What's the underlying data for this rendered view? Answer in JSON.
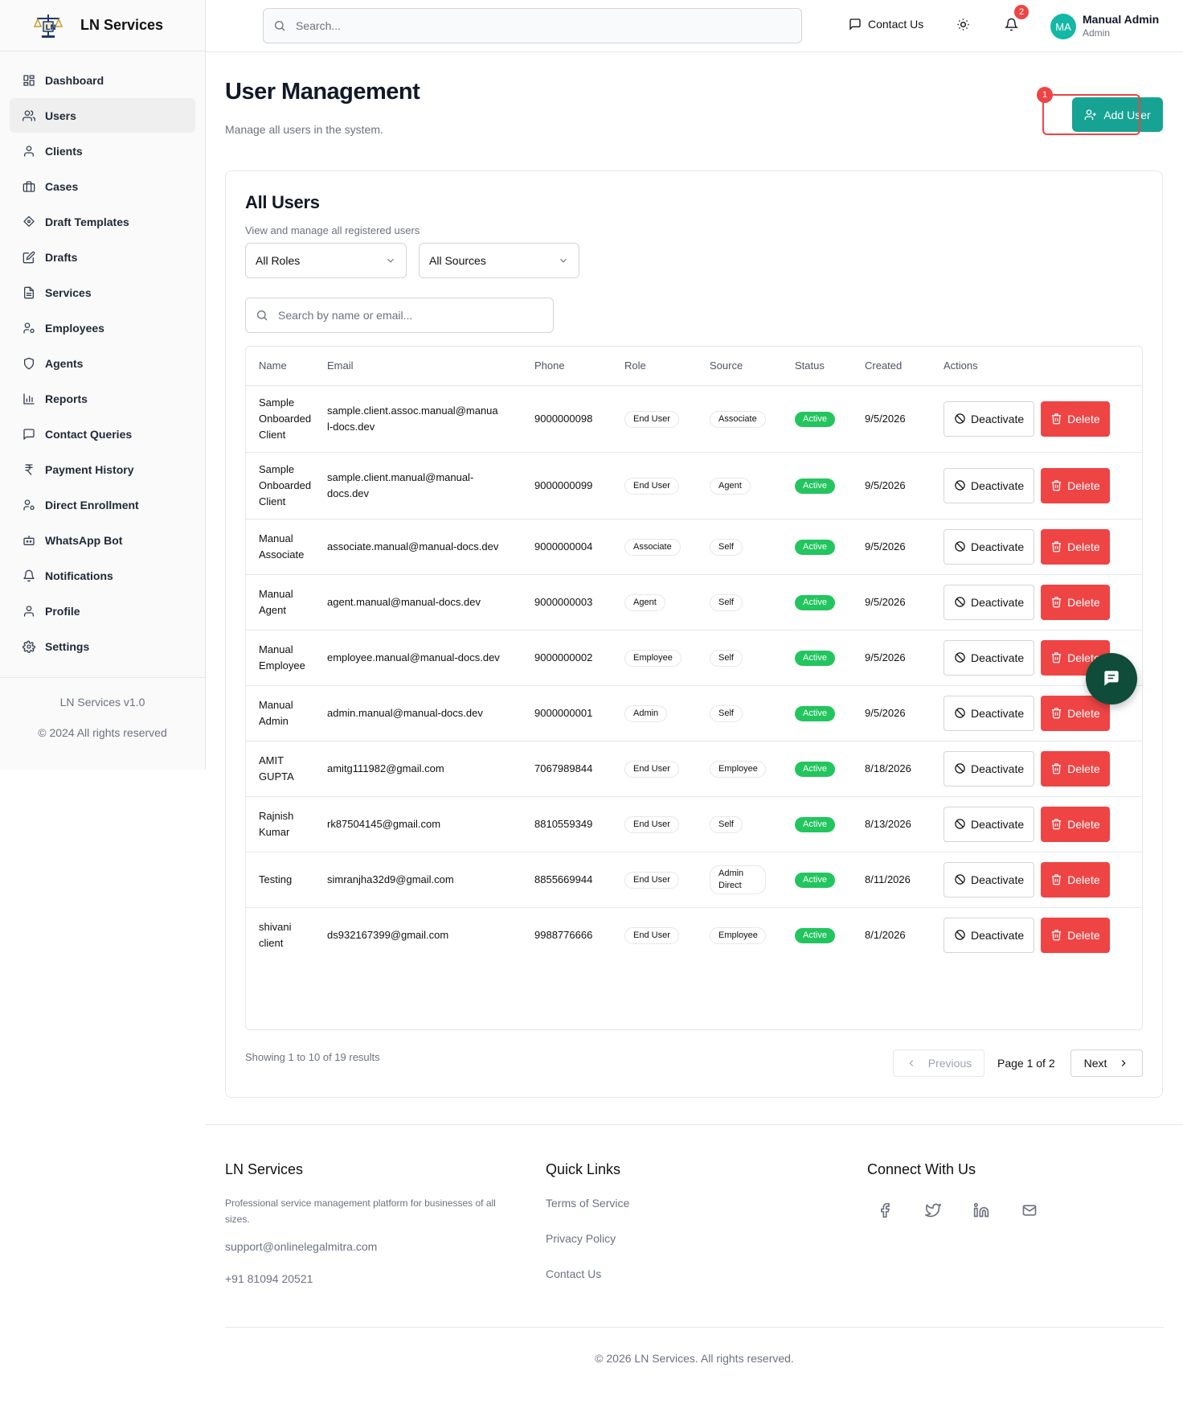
{
  "brand": {
    "name": "LN Services"
  },
  "sidebar": {
    "items": [
      {
        "label": "Dashboard",
        "icon": "dashboard-icon"
      },
      {
        "label": "Users",
        "icon": "users-icon",
        "active": true
      },
      {
        "label": "Clients",
        "icon": "user-icon"
      },
      {
        "label": "Cases",
        "icon": "briefcase-icon"
      },
      {
        "label": "Draft Templates",
        "icon": "template-icon"
      },
      {
        "label": "Drafts",
        "icon": "edit-icon"
      },
      {
        "label": "Services",
        "icon": "file-icon"
      },
      {
        "label": "Employees",
        "icon": "user-cog-icon"
      },
      {
        "label": "Agents",
        "icon": "shield-icon"
      },
      {
        "label": "Reports",
        "icon": "bar-chart-icon"
      },
      {
        "label": "Contact Queries",
        "icon": "message-icon"
      },
      {
        "label": "Payment History",
        "icon": "rupee-icon"
      },
      {
        "label": "Direct Enrollment",
        "icon": "user-cog-icon"
      },
      {
        "label": "WhatsApp Bot",
        "icon": "bot-icon"
      },
      {
        "label": "Notifications",
        "icon": "bell-icon"
      },
      {
        "label": "Profile",
        "icon": "user-icon"
      },
      {
        "label": "Settings",
        "icon": "gear-icon"
      }
    ],
    "version": "LN Services v1.0",
    "copyright": "© 2024 All rights reserved"
  },
  "header": {
    "search_placeholder": "Search...",
    "contact_label": "Contact Us",
    "notification_count": "2",
    "avatar_initials": "MA",
    "user_name": "Manual Admin",
    "user_role": "Admin"
  },
  "page": {
    "title": "User Management",
    "subtitle": "Manage all users in the system.",
    "add_button": "Add User",
    "highlight_marker": "1"
  },
  "card": {
    "title": "All Users",
    "subtitle": "View and manage all registered users",
    "role_filter": "All Roles",
    "source_filter": "All Sources",
    "search_placeholder": "Search by name or email..."
  },
  "table": {
    "headers": [
      "Name",
      "Email",
      "Phone",
      "Role",
      "Source",
      "Status",
      "Created",
      "Actions"
    ],
    "deactivate_label": "Deactivate",
    "delete_label": "Delete",
    "rows": [
      {
        "name": "Sample Onboarded Client",
        "email": "sample.client.assoc.manual@manual-docs.dev",
        "phone": "9000000098",
        "role": "End User",
        "source": "Associate",
        "status": "Active",
        "created": "9/5/2026"
      },
      {
        "name": "Sample Onboarded Client",
        "email": "sample.client.manual@manual-docs.dev",
        "phone": "9000000099",
        "role": "End User",
        "source": "Agent",
        "status": "Active",
        "created": "9/5/2026"
      },
      {
        "name": "Manual Associate",
        "email": "associate.manual@manual-docs.dev",
        "phone": "9000000004",
        "role": "Associate",
        "source": "Self",
        "status": "Active",
        "created": "9/5/2026"
      },
      {
        "name": "Manual Agent",
        "email": "agent.manual@manual-docs.dev",
        "phone": "9000000003",
        "role": "Agent",
        "source": "Self",
        "status": "Active",
        "created": "9/5/2026"
      },
      {
        "name": "Manual Employee",
        "email": "employee.manual@manual-docs.dev",
        "phone": "9000000002",
        "role": "Employee",
        "source": "Self",
        "status": "Active",
        "created": "9/5/2026"
      },
      {
        "name": "Manual Admin",
        "email": "admin.manual@manual-docs.dev",
        "phone": "9000000001",
        "role": "Admin",
        "source": "Self",
        "status": "Active",
        "created": "9/5/2026"
      },
      {
        "name": "AMIT GUPTA",
        "email": "amitg111982@gmail.com",
        "phone": "7067989844",
        "role": "End User",
        "source": "Employee",
        "status": "Active",
        "created": "8/18/2026"
      },
      {
        "name": "Rajnish Kumar",
        "email": "rk87504145@gmail.com",
        "phone": "8810559349",
        "role": "End User",
        "source": "Self",
        "status": "Active",
        "created": "8/13/2026"
      },
      {
        "name": "Testing",
        "email": "simranjha32d9@gmail.com",
        "phone": "8855669944",
        "role": "End User",
        "source": "Admin Direct",
        "status": "Active",
        "created": "8/11/2026"
      },
      {
        "name": "shivani client",
        "email": "ds932167399@gmail.com",
        "phone": "9988776666",
        "role": "End User",
        "source": "Employee",
        "status": "Active",
        "created": "8/1/2026"
      }
    ]
  },
  "pagination": {
    "showing": "Showing 1 to 10 of 19 results",
    "previous": "Previous",
    "page_label": "Page 1 of 2",
    "next": "Next"
  },
  "footer": {
    "brand_title": "LN Services",
    "description": "Professional service management platform for businesses of all sizes.",
    "email": "support@onlinelegalmitra.com",
    "phone": "+91 81094 20521",
    "quick_links_title": "Quick Links",
    "links": [
      "Terms of Service",
      "Privacy Policy",
      "Contact Us"
    ],
    "connect_title": "Connect With Us",
    "social": [
      "facebook-icon",
      "twitter-icon",
      "linkedin-icon",
      "mail-icon"
    ],
    "copyright": "© 2026 LN Services. All rights reserved."
  },
  "colors": {
    "accent": "#16a393",
    "danger": "#ef4444",
    "success": "#22c55e",
    "chat_fab": "#0f4d3a"
  }
}
